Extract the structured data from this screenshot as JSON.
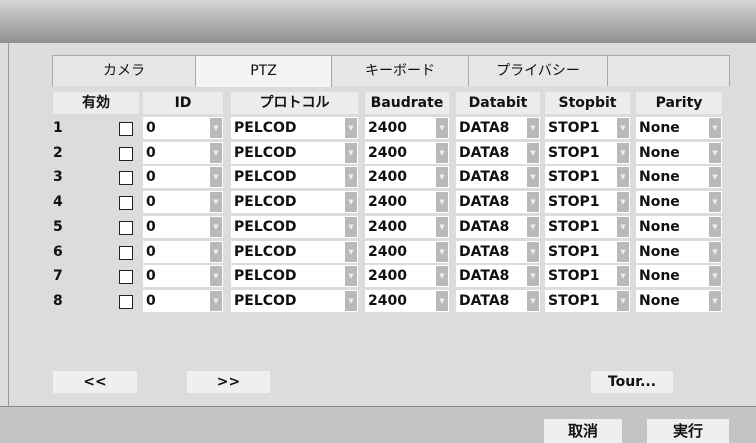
{
  "tabs": [
    {
      "label": "カメラ"
    },
    {
      "label": "PTZ"
    },
    {
      "label": "キーボード"
    },
    {
      "label": "プライバシー"
    }
  ],
  "columns": {
    "enable": "有効",
    "id": "ID",
    "protocol": "プロトコル",
    "baudrate": "Baudrate",
    "databit": "Databit",
    "stopbit": "Stopbit",
    "parity": "Parity"
  },
  "rows": [
    {
      "num": "1",
      "id": "0",
      "protocol": "PELCOD",
      "baudrate": "2400",
      "databit": "DATA8",
      "stopbit": "STOP1",
      "parity": "None"
    },
    {
      "num": "2",
      "id": "0",
      "protocol": "PELCOD",
      "baudrate": "2400",
      "databit": "DATA8",
      "stopbit": "STOP1",
      "parity": "None"
    },
    {
      "num": "3",
      "id": "0",
      "protocol": "PELCOD",
      "baudrate": "2400",
      "databit": "DATA8",
      "stopbit": "STOP1",
      "parity": "None"
    },
    {
      "num": "4",
      "id": "0",
      "protocol": "PELCOD",
      "baudrate": "2400",
      "databit": "DATA8",
      "stopbit": "STOP1",
      "parity": "None"
    },
    {
      "num": "5",
      "id": "0",
      "protocol": "PELCOD",
      "baudrate": "2400",
      "databit": "DATA8",
      "stopbit": "STOP1",
      "parity": "None"
    },
    {
      "num": "6",
      "id": "0",
      "protocol": "PELCOD",
      "baudrate": "2400",
      "databit": "DATA8",
      "stopbit": "STOP1",
      "parity": "None"
    },
    {
      "num": "7",
      "id": "0",
      "protocol": "PELCOD",
      "baudrate": "2400",
      "databit": "DATA8",
      "stopbit": "STOP1",
      "parity": "None"
    },
    {
      "num": "8",
      "id": "0",
      "protocol": "PELCOD",
      "baudrate": "2400",
      "databit": "DATA8",
      "stopbit": "STOP1",
      "parity": "None"
    }
  ],
  "buttons": {
    "prev": "<<",
    "next": ">>",
    "tour": "Tour...",
    "cancel": "取消",
    "execute": "実行"
  },
  "icons": {
    "dropdown_arrow": "dropdown-arrow-icon"
  }
}
